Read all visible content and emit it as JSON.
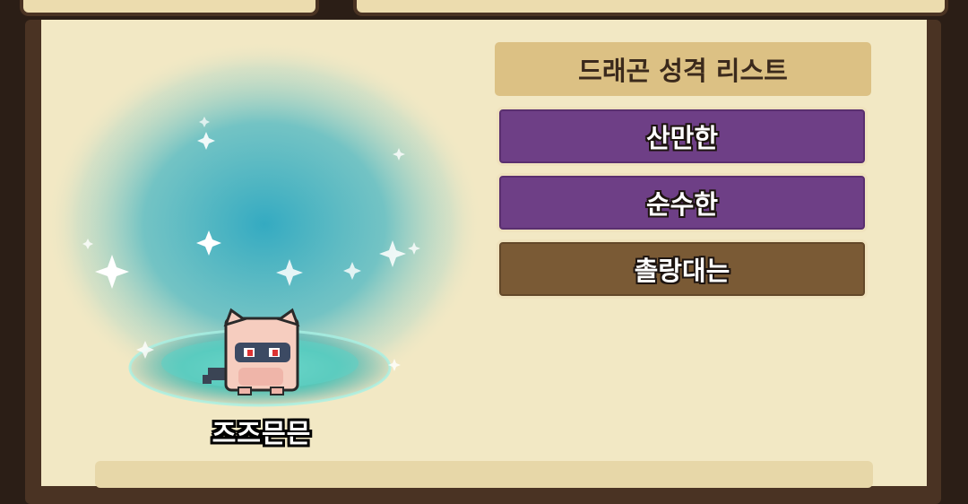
{
  "dragon": {
    "name": "즈즈믄믄"
  },
  "trait_list": {
    "title": "드래곤 성격 리스트",
    "items": [
      {
        "label": "산만한",
        "color": "#6e3f86"
      },
      {
        "label": "순수한",
        "color": "#6e3f86"
      },
      {
        "label": "촐랑대는",
        "color": "#7a5a35"
      }
    ]
  },
  "colors": {
    "panel_bg": "#f2e8c4",
    "frame": "#4a3323",
    "header_bg": "#dcc184",
    "glow": "#3fb4c6"
  }
}
